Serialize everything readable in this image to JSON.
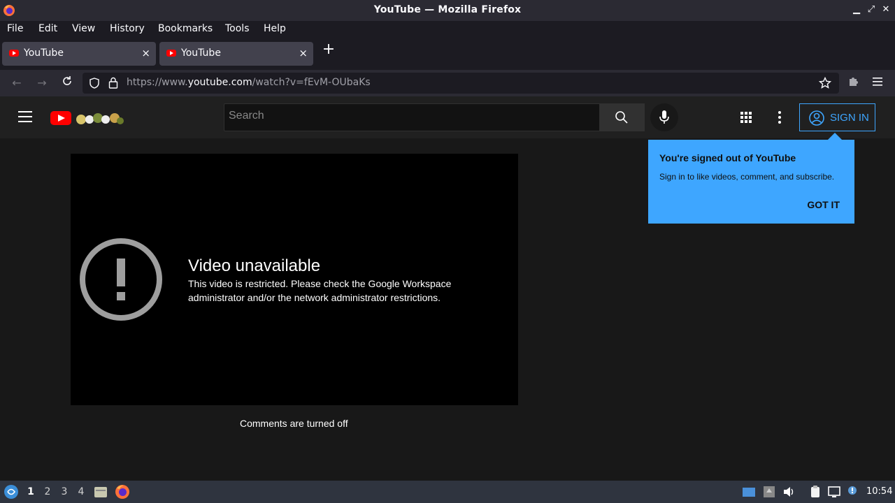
{
  "window": {
    "title": "YouTube — Mozilla Firefox"
  },
  "menu": {
    "file": "File",
    "edit": "Edit",
    "view": "View",
    "history": "History",
    "bookmarks": "Bookmarks",
    "tools": "Tools",
    "help": "Help"
  },
  "tabs": [
    {
      "label": "YouTube",
      "close": "×"
    },
    {
      "label": "YouTube",
      "close": "×"
    }
  ],
  "newtab": "+",
  "urlbar": {
    "prefix": "https://www.",
    "domain": "youtube.com",
    "path": "/watch?v=fEvM-OUbaKs"
  },
  "yt": {
    "search_placeholder": "Search",
    "signin_label": "SIGN IN"
  },
  "player": {
    "title": "Video unavailable",
    "message": "This video is restricted. Please check the Google Workspace administrator and/or the network administrator restrictions."
  },
  "comments": "Comments are turned off",
  "popup": {
    "title": "You're signed out of YouTube",
    "message": "Sign in to like videos, comment, and subscribe.",
    "button": "GOT IT"
  },
  "taskbar": {
    "workspaces": [
      "1",
      "2",
      "3",
      "4"
    ],
    "clock": "10:54"
  },
  "colors": {
    "accent": "#3ea6ff",
    "yt_red": "#ff0000",
    "bg": "#181818"
  }
}
